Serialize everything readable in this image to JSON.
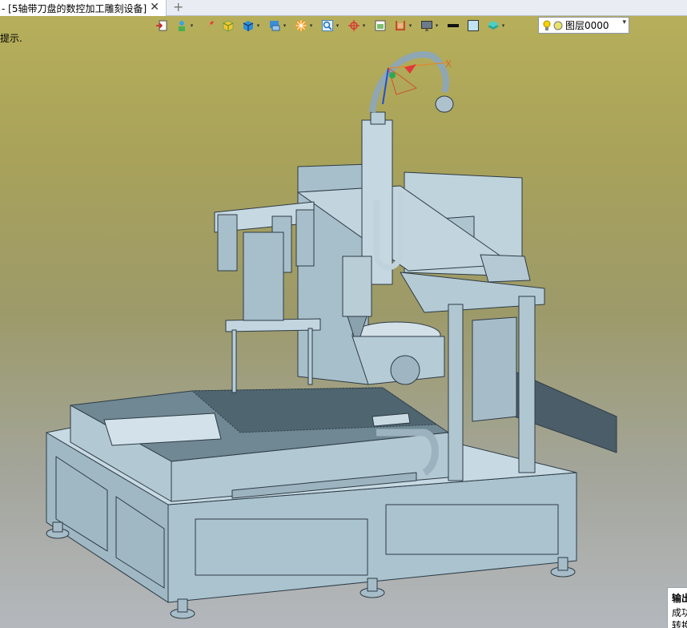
{
  "tab": {
    "title": "- [5轴带刀盘的数控加工雕刻设备]",
    "close_glyph": "✕",
    "add_glyph": "+"
  },
  "hint": "提示.",
  "toolbar": {
    "items": [
      "export-icon",
      "render-icon",
      "brush-icon",
      "cube-icon",
      "solid-icon",
      "view-icon",
      "color-wheel-icon",
      "zoom-icon",
      "axis-icon",
      "sketch-icon",
      "align-icon",
      "display-icon",
      "line-icon",
      "plane-icon",
      "layer-stack-icon"
    ]
  },
  "layer": {
    "name": "图层0000",
    "colors": {
      "bulb": "#f5d400",
      "dot": "#e8e36a"
    }
  },
  "output_panel": {
    "title": "输出",
    "line1": "成功",
    "line2": "转换"
  },
  "colors": {
    "machine": "#b7cdd8",
    "edge": "#2d3b45",
    "dark": "#7e949f"
  }
}
